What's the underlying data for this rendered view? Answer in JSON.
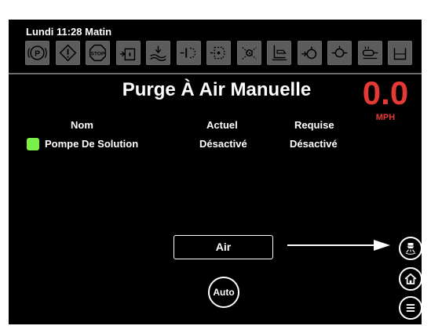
{
  "header": {
    "datetime": "Lundi 11:28 Matin",
    "status_icons": [
      {
        "name": "parking-brake-icon",
        "glyph": "P"
      },
      {
        "name": "warning-icon",
        "glyph": "!"
      },
      {
        "name": "stop-icon",
        "glyph": "STOP"
      },
      {
        "name": "solution-tank-icon",
        "glyph": ""
      },
      {
        "name": "recovery-tank-icon",
        "glyph": ""
      },
      {
        "name": "brush-icon",
        "glyph": ""
      },
      {
        "name": "scrub-brush-icon",
        "glyph": ""
      },
      {
        "name": "side-brush-icon",
        "glyph": ""
      },
      {
        "name": "squeegee-icon",
        "glyph": ""
      },
      {
        "name": "detergent-icon",
        "glyph": ""
      },
      {
        "name": "engine-oil-icon",
        "glyph": ""
      },
      {
        "name": "filter-icon",
        "glyph": ""
      },
      {
        "name": "hopper-icon",
        "glyph": ""
      }
    ]
  },
  "main": {
    "title": "Purge À Air Manuelle",
    "speed": {
      "value": "0.0",
      "unit": "MPH"
    },
    "table": {
      "headers": [
        "Nom",
        "Actuel",
        "Requise"
      ],
      "rows": [
        {
          "name": "Pompe De Solution",
          "actual": "Désactivé",
          "required": "Désactivé",
          "indicator_color": "#7cf04a"
        }
      ]
    },
    "air_button_label": "Air",
    "auto_button_label": "Auto"
  },
  "side_buttons": [
    {
      "name": "spray-nozzle-icon"
    },
    {
      "name": "home-icon"
    },
    {
      "name": "menu-icon"
    }
  ],
  "colors": {
    "background": "#000000",
    "accent_red": "#e53935",
    "status_green": "#7cf04a",
    "icon_gray": "#5c5c5c"
  }
}
